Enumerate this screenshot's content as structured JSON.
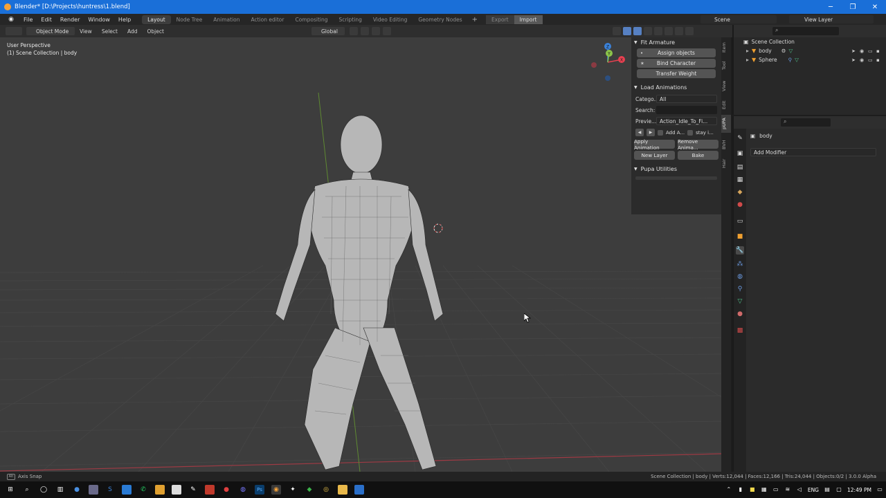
{
  "window": {
    "title": "Blender* [D:\\Projects\\huntress\\1.blend]",
    "minimize": "─",
    "maximize": "❐",
    "close": "✕"
  },
  "menubar": {
    "items": [
      "File",
      "Edit",
      "Render",
      "Window",
      "Help"
    ],
    "workspaces": [
      "Layout",
      "Node Tree",
      "Animation",
      "Action editor",
      "Compositing",
      "Scripting",
      "Video Editing",
      "Geometry Nodes"
    ],
    "active_workspace": "Layout",
    "add_workspace": "+",
    "export_label": "Export",
    "import_label": "Import",
    "scene": "Scene",
    "view_layer": "View Layer"
  },
  "viewport_header": {
    "mode": "Object Mode",
    "menus": [
      "View",
      "Select",
      "Add",
      "Object"
    ],
    "orientation": "Global"
  },
  "viewport": {
    "perspective": "User Perspective",
    "collection_info": "(1) Scene Collection | body",
    "gizmo": {
      "x": "X",
      "y": "Y",
      "z": "Z"
    }
  },
  "npanel": {
    "fit_armature": {
      "title": "Fit Armature",
      "assign_objects": "Assign objects",
      "bind_character": "Bind Character",
      "transfer_weight": "Transfer Weight"
    },
    "load_animations": {
      "title": "Load Animations",
      "category_label": "Catego...",
      "category_value": "All",
      "search_label": "Search:",
      "search_value": "",
      "preview_label": "Previe...",
      "preview_value": "Action_Idle_To_Fi...",
      "add_action_label": "Add A...",
      "stay_label": "stay i...",
      "apply_animation": "Apply Animation",
      "remove_animation": "Remove Anima...",
      "new_layer": "New Layer",
      "bake": "Bake"
    },
    "pupa_utilities": {
      "title": "Pupa Utilities"
    }
  },
  "vertical_tabs": [
    "Item",
    "Tool",
    "View",
    "Edit",
    "pUPA",
    "BVH",
    "Hair"
  ],
  "active_vertical_tab": "pUPA",
  "outliner": {
    "root": "Scene Collection",
    "items": [
      {
        "name": "body"
      },
      {
        "name": "Sphere"
      }
    ]
  },
  "properties": {
    "object_name": "body",
    "add_modifier": "Add Modifier"
  },
  "statusbar": {
    "key": "Alt",
    "left": "Axis Snap",
    "right": "Scene Collection | body | Verts:12,044 | Faces:12,166 | Tris:24,044 | Objects:0/2 | 3.0.0 Alpha"
  },
  "taskbar": {
    "language": "ENG",
    "time": "12:49 PM"
  },
  "colors": {
    "titlebar": "#1a6fd8",
    "viewport_bg": "#3d3d3d",
    "x_axis": "#e84050",
    "y_axis": "#8bc34a",
    "z_axis": "#3b82d9",
    "accent": "#5680c2"
  }
}
